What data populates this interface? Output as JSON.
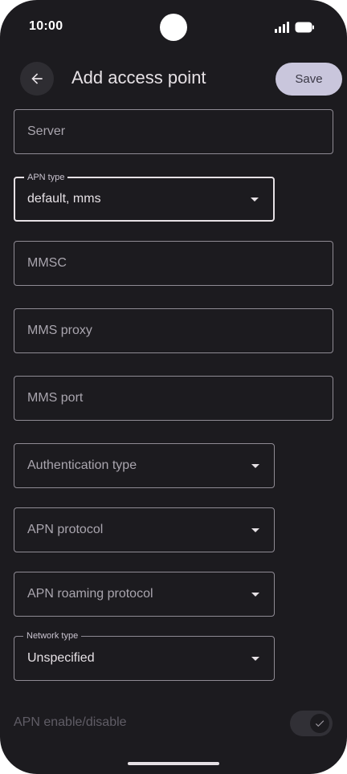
{
  "status_bar": {
    "time": "10:00",
    "icons": [
      "signal-icon",
      "battery-icon"
    ]
  },
  "app_bar": {
    "back_icon": "arrow-left-icon",
    "title": "Add access point",
    "save_label": "Save"
  },
  "fields": {
    "server": {
      "placeholder": "Server"
    },
    "apn_type": {
      "label": "APN type",
      "value": "default, mms"
    },
    "mmsc": {
      "placeholder": "MMSC"
    },
    "mms_proxy": {
      "placeholder": "MMS proxy"
    },
    "mms_port": {
      "placeholder": "MMS port"
    },
    "authentication_type": {
      "placeholder": "Authentication type"
    },
    "apn_protocol": {
      "placeholder": "APN protocol"
    },
    "apn_roaming_protocol": {
      "placeholder": "APN roaming protocol"
    },
    "network_type": {
      "label": "Network type",
      "value": "Unspecified"
    }
  },
  "apn_enable": {
    "label": "APN enable/disable",
    "checked": true,
    "enabled": false
  },
  "colors": {
    "background": "#1c1b1f",
    "on_surface": "#e6e1e5",
    "outline": "#8f8b94",
    "save_button": "#c9c6dc"
  }
}
